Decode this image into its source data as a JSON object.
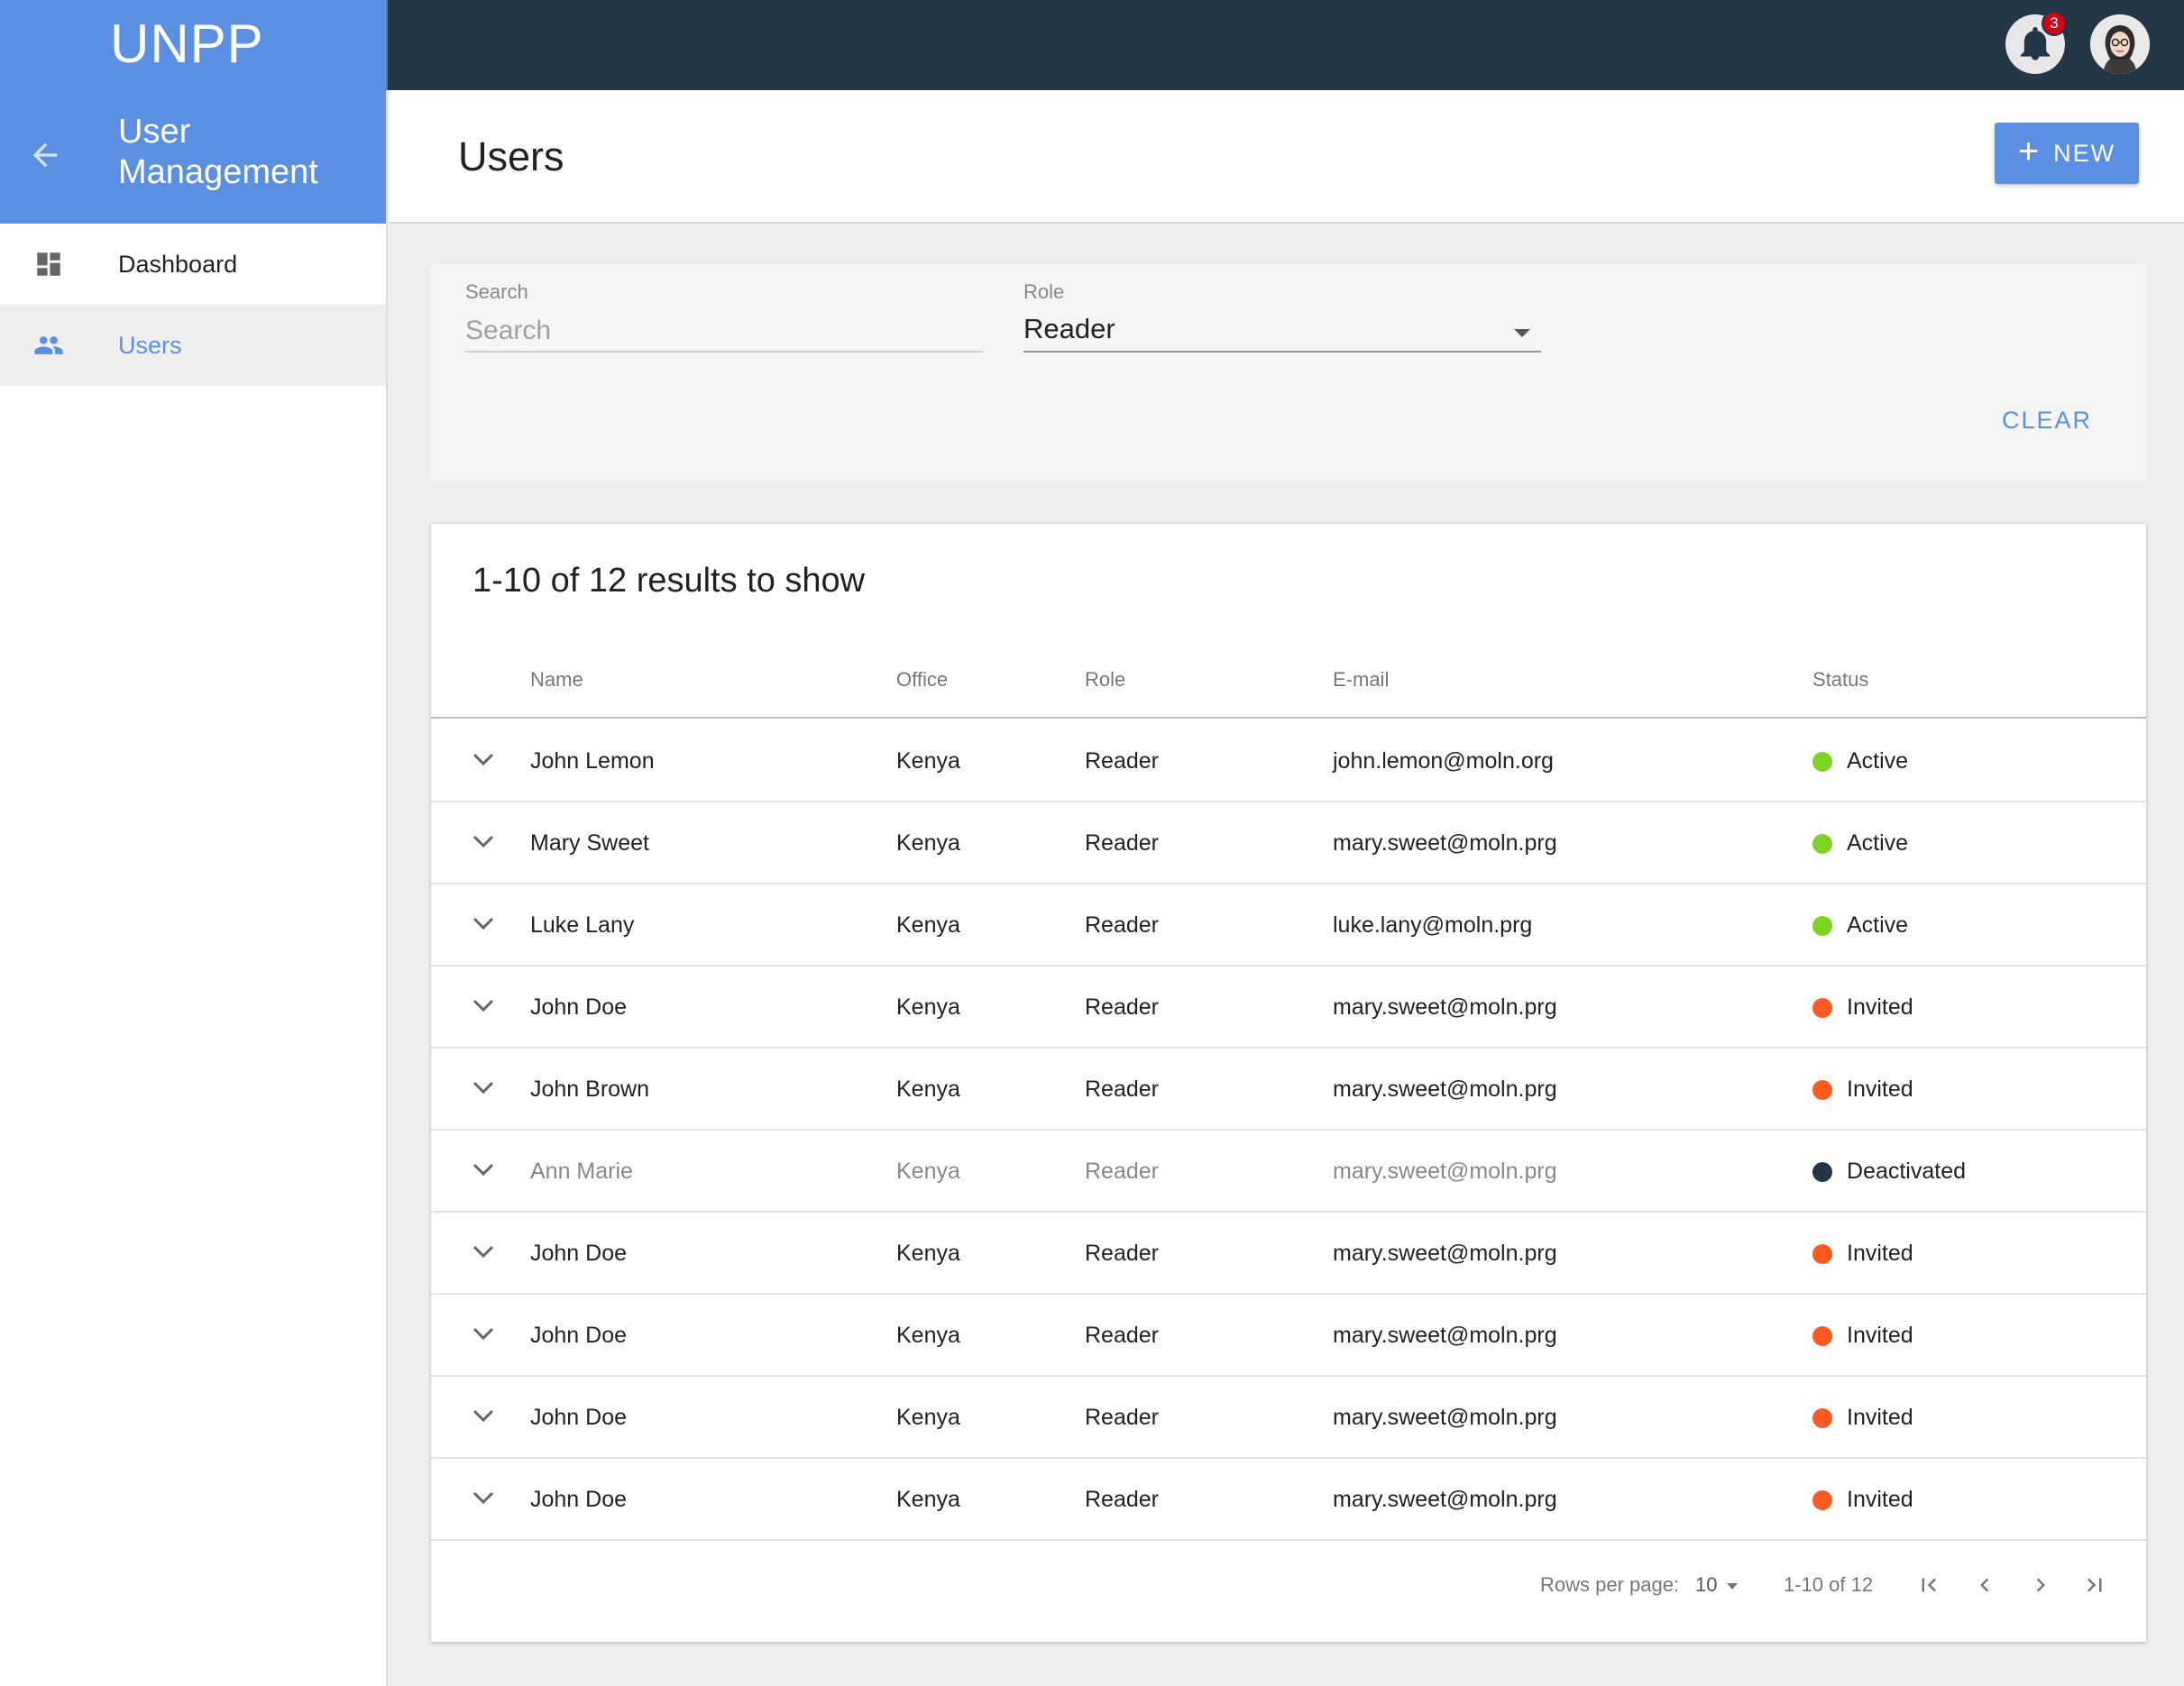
{
  "app": {
    "brand": "UNPP",
    "notification_count": "3"
  },
  "sidebar": {
    "title": "User Management",
    "items": [
      {
        "label": "Dashboard"
      },
      {
        "label": "Users"
      }
    ]
  },
  "header": {
    "title": "Users",
    "new_label": "NEW"
  },
  "filters": {
    "search_label": "Search",
    "search_placeholder": "Search",
    "search_value": "",
    "role_label": "Role",
    "role_value": "Reader",
    "clear_label": "CLEAR"
  },
  "table": {
    "results_text": "1-10 of 12 results to show",
    "columns": {
      "name": "Name",
      "office": "Office",
      "role": "Role",
      "email": "E-mail",
      "status": "Status"
    },
    "rows": [
      {
        "name": "John Lemon",
        "office": "Kenya",
        "role": "Reader",
        "email": "john.lemon@moln.org",
        "status": "Active"
      },
      {
        "name": "Mary Sweet",
        "office": "Kenya",
        "role": "Reader",
        "email": "mary.sweet@moln.prg",
        "status": "Active"
      },
      {
        "name": "Luke Lany",
        "office": "Kenya",
        "role": "Reader",
        "email": "luke.lany@moln.prg",
        "status": "Active"
      },
      {
        "name": "John Doe",
        "office": "Kenya",
        "role": "Reader",
        "email": "mary.sweet@moln.prg",
        "status": "Invited"
      },
      {
        "name": "John Brown",
        "office": "Kenya",
        "role": "Reader",
        "email": "mary.sweet@moln.prg",
        "status": "Invited"
      },
      {
        "name": "Ann Marie",
        "office": "Kenya",
        "role": "Reader",
        "email": "mary.sweet@moln.prg",
        "status": "Deactivated"
      },
      {
        "name": "John Doe",
        "office": "Kenya",
        "role": "Reader",
        "email": "mary.sweet@moln.prg",
        "status": "Invited"
      },
      {
        "name": "John Doe",
        "office": "Kenya",
        "role": "Reader",
        "email": "mary.sweet@moln.prg",
        "status": "Invited"
      },
      {
        "name": "John Doe",
        "office": "Kenya",
        "role": "Reader",
        "email": "mary.sweet@moln.prg",
        "status": "Invited"
      },
      {
        "name": "John Doe",
        "office": "Kenya",
        "role": "Reader",
        "email": "mary.sweet@moln.prg",
        "status": "Invited"
      }
    ]
  },
  "pagination": {
    "rows_per_page_label": "Rows per page:",
    "rows_per_page_value": "10",
    "range_text": "1-10 of 12"
  },
  "colors": {
    "brand": "#5b8fe2",
    "topbar": "#243746",
    "status_active": "#7ed321",
    "status_invited": "#ff5a1f",
    "status_deactivated": "#243746"
  },
  "icons": {
    "topbar": [
      "bell-icon",
      "avatar"
    ],
    "sidebar": [
      "arrow-back-icon",
      "dashboard-icon",
      "people-icon"
    ],
    "rows": "chevron-down-icon",
    "pager": [
      "first-page-icon",
      "chevron-left-icon",
      "chevron-right-icon",
      "last-page-icon"
    ]
  }
}
